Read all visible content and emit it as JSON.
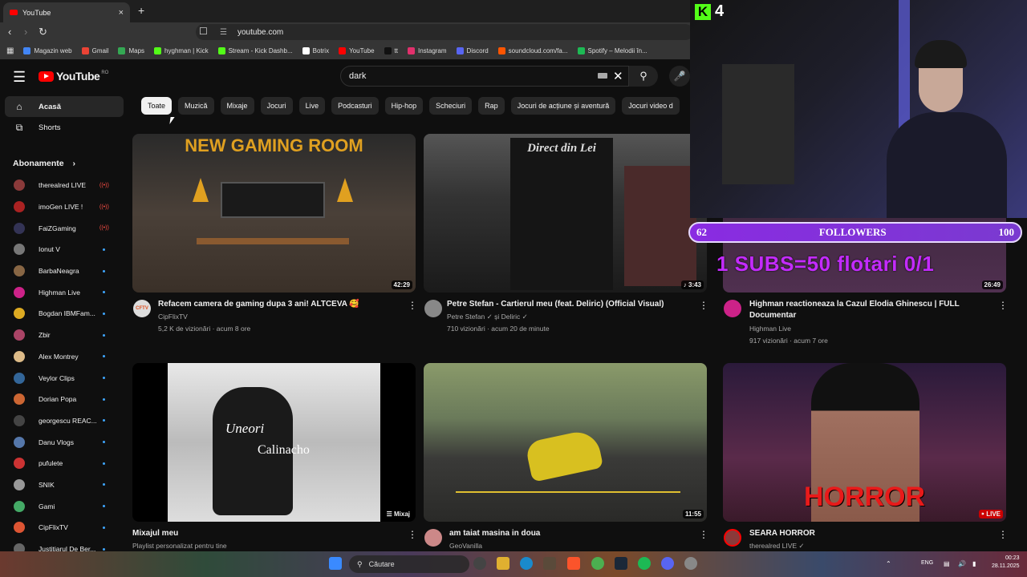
{
  "browser": {
    "tab_title": "YouTube",
    "new_tab": "+",
    "close": "×",
    "url": "youtube.com",
    "bookmarks": [
      {
        "label": "Magazin web",
        "color": "#4285f4"
      },
      {
        "label": "Gmail",
        "color": "#ea4335"
      },
      {
        "label": "Maps",
        "color": "#34a853"
      },
      {
        "label": "hyghman | Kick",
        "color": "#53fc18"
      },
      {
        "label": "Stream - Kick Dashb...",
        "color": "#53fc18"
      },
      {
        "label": "Botrix",
        "color": "#ffffff"
      },
      {
        "label": "YouTube",
        "color": "#ff0000"
      },
      {
        "label": "tt",
        "color": "#111111"
      },
      {
        "label": "Instagram",
        "color": "#e1306c"
      },
      {
        "label": "Discord",
        "color": "#5865f2"
      },
      {
        "label": "soundcloud.com/fa...",
        "color": "#ff5500"
      },
      {
        "label": "Spotify – Melodii în...",
        "color": "#1db954"
      }
    ]
  },
  "header": {
    "logo": "YouTube",
    "region": "RO",
    "search_value": "dark"
  },
  "chips": [
    "Toate",
    "Muzică",
    "Mixaje",
    "Jocuri",
    "Live",
    "Podcasturi",
    "Hip-hop",
    "Scheciuri",
    "Rap",
    "Jocuri de acțiune și aventură",
    "Jocuri video d"
  ],
  "sidebar": {
    "nav": [
      {
        "label": "Acasă",
        "icon": "home-icon"
      },
      {
        "label": "Shorts",
        "icon": "shorts-icon"
      }
    ],
    "subs_heading": "Abonamente",
    "subs": [
      {
        "name": "therealred LIVE",
        "live": true,
        "color": "#8a3a3a"
      },
      {
        "name": "imoGen LIVE !",
        "live": true,
        "color": "#aa2222"
      },
      {
        "name": "FaiZGaming",
        "live": true,
        "color": "#333355"
      },
      {
        "name": "Ionut V",
        "live": false,
        "color": "#777777"
      },
      {
        "name": "BarbaNeagra",
        "live": false,
        "color": "#886644"
      },
      {
        "name": "Highman Live",
        "live": false,
        "color": "#cc2288"
      },
      {
        "name": "Bogdan IBMFam...",
        "live": false,
        "color": "#ddaa22"
      },
      {
        "name": "Zbir",
        "live": false,
        "color": "#aa4466"
      },
      {
        "name": "Alex Montrey",
        "live": false,
        "color": "#ddbb88"
      },
      {
        "name": "Veylor Clips",
        "live": false,
        "color": "#336699"
      },
      {
        "name": "Dorian Popa",
        "live": false,
        "color": "#cc6633"
      },
      {
        "name": "georgescu REAC...",
        "live": false,
        "color": "#444444"
      },
      {
        "name": "Danu Vlogs",
        "live": false,
        "color": "#5577aa"
      },
      {
        "name": "pufulete",
        "live": false,
        "color": "#cc3333"
      },
      {
        "name": "SNIK",
        "live": false,
        "color": "#999999"
      },
      {
        "name": "Gami",
        "live": false,
        "color": "#44aa66"
      },
      {
        "name": "CipFlixTV",
        "live": false,
        "color": "#dd5533"
      },
      {
        "name": "Justitiarul De Ber...",
        "live": false,
        "color": "#666666"
      }
    ]
  },
  "videos": [
    {
      "title": "Refacem camera de gaming dupa 3 ani! ALTCEVA 🥰",
      "channel": "CipFlixTV",
      "meta": "5,2 K de vizionări · acum 8 ore",
      "duration": "42:29",
      "thumb_text": "NEW GAMING ROOM"
    },
    {
      "title": "Petre Stefan - Cartierul meu (feat. Deliric) (Official Visual)",
      "channel": "Petre Stefan ✓ și Deliric ✓",
      "meta": "710 vizionări · acum 20 de minute",
      "duration": "♪ 3:43",
      "thumb_text": "Direct din Lei"
    },
    {
      "title": "Highman reactioneaza la Cazul Elodia Ghinescu | FULL Documentar",
      "channel": "Highman Live",
      "meta": "917 vizionări · acum 7 ore",
      "duration": "26:49",
      "thumb_text": ""
    },
    {
      "title": "Mixajul meu",
      "channel": "Playlist personalizat pentru tine",
      "meta": "",
      "duration": "Mixaj",
      "thumb_text": "Uneori",
      "thumb_text2": "Calinacho"
    },
    {
      "title": "am taiat masina in doua",
      "channel": "GeoVanilla",
      "meta": "",
      "duration": "11:55",
      "thumb_text": ""
    },
    {
      "title": "SEARA HORROR",
      "channel": "therealred LIVE ✓",
      "meta": "",
      "duration": "LIVE",
      "thumb_text": "HORROR"
    }
  ],
  "overlay": {
    "viewers": "4",
    "follow_current": "62",
    "follow_label": "FOLLOWERS",
    "follow_goal": "100",
    "subs_goal": "1 SUBS=50 flotari 0/1"
  },
  "taskbar": {
    "search_label": "Căutare",
    "lang": "ENG",
    "time": "00:23",
    "date": "28.11.2025"
  }
}
